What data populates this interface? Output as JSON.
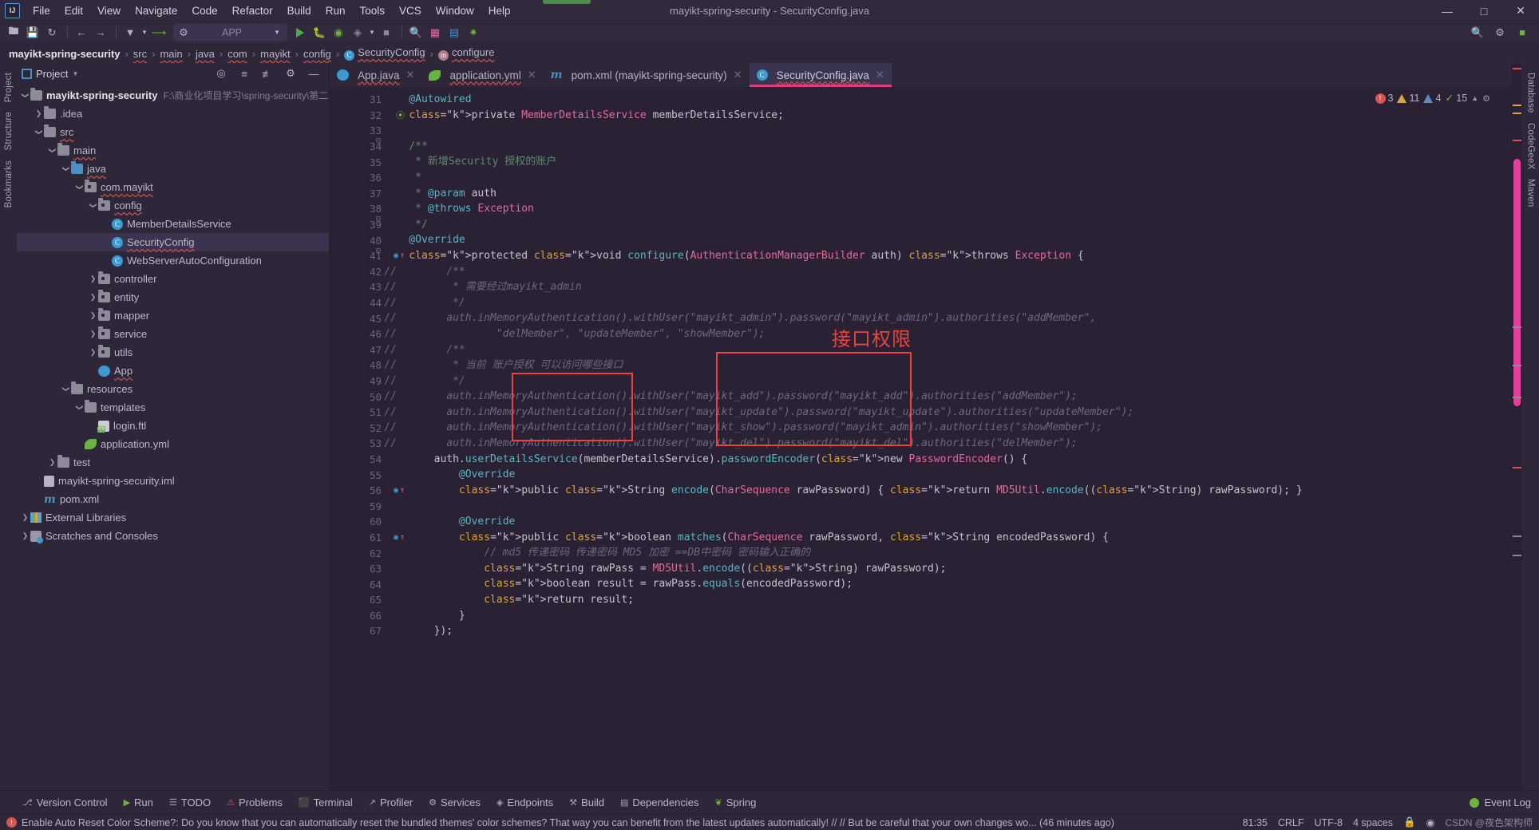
{
  "window": {
    "title": "mayikt-spring-security - SecurityConfig.java",
    "controls": {
      "minimize": "—",
      "maximize": "□",
      "close": "✕"
    }
  },
  "menu": [
    "File",
    "Edit",
    "View",
    "Navigate",
    "Code",
    "Refactor",
    "Build",
    "Run",
    "Tools",
    "VCS",
    "Window",
    "Help"
  ],
  "toolbar": {
    "run_config": "APP",
    "icons": [
      "open-folder-icon",
      "save-icon",
      "sync-icon",
      "back-arrow-icon",
      "forward-arrow-icon",
      "vcs-update-icon",
      "vcs-commit-icon",
      "run-icon",
      "debug-icon",
      "run-coverage-icon",
      "profile-icon",
      "stop-icon",
      "search-everywhere-icon",
      "structure-icon",
      "database-icon",
      "plugin-icon",
      "build-icon",
      "ai-icon"
    ],
    "right_icons": [
      "search-icon",
      "settings-icon",
      "account-icon"
    ]
  },
  "breadcrumb": [
    {
      "label": "mayikt-spring-security",
      "icon": "",
      "first": true
    },
    {
      "label": "src",
      "icon": ""
    },
    {
      "label": "main",
      "icon": ""
    },
    {
      "label": "java",
      "icon": ""
    },
    {
      "label": "com",
      "icon": ""
    },
    {
      "label": "mayikt",
      "icon": ""
    },
    {
      "label": "config",
      "icon": ""
    },
    {
      "label": "SecurityConfig",
      "icon": "C"
    },
    {
      "label": "configure",
      "icon": "m"
    }
  ],
  "left_strip": [
    "Project",
    "Structure",
    "Bookmarks"
  ],
  "right_strip": [
    "Database",
    "CodeGeeX",
    "Maven"
  ],
  "project_panel": {
    "title": "Project",
    "header_icons": [
      "locate-icon",
      "expand-all-icon",
      "collapse-all-icon",
      "settings-icon",
      "hide-icon"
    ],
    "tree": [
      {
        "indent": 0,
        "arrow": "v",
        "icon": "module",
        "label": "mayikt-spring-security",
        "bold": true,
        "path": "F:\\商业化项目学习\\spring-security\\第二次学\\spring-s"
      },
      {
        "indent": 1,
        "arrow": ">",
        "icon": "folder",
        "label": ".idea"
      },
      {
        "indent": 1,
        "arrow": "v",
        "icon": "folder",
        "label": "src",
        "wavy": true
      },
      {
        "indent": 2,
        "arrow": "v",
        "icon": "folder",
        "label": "main",
        "wavy": true
      },
      {
        "indent": 3,
        "arrow": "v",
        "icon": "folder-blue",
        "label": "java",
        "wavy": true
      },
      {
        "indent": 4,
        "arrow": "v",
        "icon": "package",
        "label": "com.mayikt",
        "wavy": true
      },
      {
        "indent": 5,
        "arrow": "v",
        "icon": "package",
        "label": "config",
        "wavy": true
      },
      {
        "indent": 6,
        "arrow": "",
        "icon": "class",
        "label": "MemberDetailsService"
      },
      {
        "indent": 6,
        "arrow": "",
        "icon": "class",
        "label": "SecurityConfig",
        "selected": true,
        "wavy": true
      },
      {
        "indent": 6,
        "arrow": "",
        "icon": "class",
        "label": "WebServerAutoConfiguration"
      },
      {
        "indent": 5,
        "arrow": ">",
        "icon": "package",
        "label": "controller"
      },
      {
        "indent": 5,
        "arrow": ">",
        "icon": "package",
        "label": "entity"
      },
      {
        "indent": 5,
        "arrow": ">",
        "icon": "package",
        "label": "mapper"
      },
      {
        "indent": 5,
        "arrow": ">",
        "icon": "package",
        "label": "service"
      },
      {
        "indent": 5,
        "arrow": ">",
        "icon": "package",
        "label": "utils"
      },
      {
        "indent": 5,
        "arrow": "",
        "icon": "spring-class",
        "label": "App",
        "wavy": true
      },
      {
        "indent": 3,
        "arrow": "v",
        "icon": "resources",
        "label": "resources"
      },
      {
        "indent": 4,
        "arrow": "v",
        "icon": "folder",
        "label": "templates"
      },
      {
        "indent": 5,
        "arrow": "",
        "icon": "ftl",
        "label": "login.ftl"
      },
      {
        "indent": 4,
        "arrow": "",
        "icon": "yml",
        "label": "application.yml"
      },
      {
        "indent": 2,
        "arrow": ">",
        "icon": "folder",
        "label": "test"
      },
      {
        "indent": 1,
        "arrow": "",
        "icon": "iml",
        "label": "mayikt-spring-security.iml"
      },
      {
        "indent": 1,
        "arrow": "",
        "icon": "maven",
        "label": "pom.xml"
      },
      {
        "indent": 0,
        "arrow": ">",
        "icon": "library",
        "label": "External Libraries"
      },
      {
        "indent": 0,
        "arrow": ">",
        "icon": "scratch",
        "label": "Scratches and Consoles"
      }
    ]
  },
  "editor": {
    "tabs": [
      {
        "label": "App.java",
        "icon": "spring-class-icon",
        "active": false,
        "wavy": true
      },
      {
        "label": "application.yml",
        "icon": "spring-yml-icon",
        "active": false,
        "wavy": true
      },
      {
        "label": "pom.xml (mayikt-spring-security)",
        "icon": "maven-icon",
        "active": false
      },
      {
        "label": "SecurityConfig.java",
        "icon": "class-icon",
        "active": true,
        "wavy": true
      }
    ],
    "inspection": {
      "errors": "3",
      "warnings": "11",
      "weak_warnings": "4",
      "typos": "15"
    },
    "first_line_number": 31,
    "lines": [
      {
        "n": 31,
        "text": "    @Autowired"
      },
      {
        "n": 32,
        "text": "    private MemberDetailsService memberDetailsService;",
        "bean": true
      },
      {
        "n": 33,
        "text": ""
      },
      {
        "n": 34,
        "text": "    /**"
      },
      {
        "n": 35,
        "text": "     * 新增Security 授权的账户"
      },
      {
        "n": 36,
        "text": "     *"
      },
      {
        "n": 37,
        "text": "     * @param auth"
      },
      {
        "n": 38,
        "text": "     * @throws Exception"
      },
      {
        "n": 39,
        "text": "     */"
      },
      {
        "n": 40,
        "text": "    @Override"
      },
      {
        "n": 41,
        "text": "    protected void configure(AuthenticationManagerBuilder auth) throws Exception {",
        "override": true
      },
      {
        "n": 42,
        "text": "//        /**",
        "commented": true
      },
      {
        "n": 43,
        "text": "//         * 需要经过mayikt_admin",
        "commented": true
      },
      {
        "n": 44,
        "text": "//         */",
        "commented": true
      },
      {
        "n": 45,
        "text": "//        auth.inMemoryAuthentication().withUser(\"mayikt_admin\").password(\"mayikt_admin\").authorities(\"addMember\",",
        "commented": true
      },
      {
        "n": 46,
        "text": "//                \"delMember\", \"updateMember\", \"showMember\");",
        "commented": true
      },
      {
        "n": 47,
        "text": "//        /**",
        "commented": true
      },
      {
        "n": 48,
        "text": "//         * 当前 账户授权 可以访问哪些接口",
        "commented": true
      },
      {
        "n": 49,
        "text": "//         */",
        "commented": true
      },
      {
        "n": 50,
        "text": "//        auth.inMemoryAuthentication().withUser(\"mayikt_add\").password(\"mayikt_add\").authorities(\"addMember\");",
        "commented": true
      },
      {
        "n": 51,
        "text": "//        auth.inMemoryAuthentication().withUser(\"mayikt_update\").password(\"mayikt_update\").authorities(\"updateMember\");",
        "commented": true
      },
      {
        "n": 52,
        "text": "//        auth.inMemoryAuthentication().withUser(\"mayikt_show\").password(\"mayikt_admin\").authorities(\"showMember\");",
        "commented": true
      },
      {
        "n": 53,
        "text": "//        auth.inMemoryAuthentication().withUser(\"mayikt_del\").password(\"mayikt_del\").authorities(\"delMember\");",
        "commented": true
      },
      {
        "n": 54,
        "text": "        auth.userDetailsService(memberDetailsService).passwordEncoder(new PasswordEncoder() {"
      },
      {
        "n": 55,
        "text": "            @Override"
      },
      {
        "n": 56,
        "text": "            public String encode(CharSequence rawPassword) { return MD5Util.encode((String) rawPassword); }",
        "override": true
      },
      {
        "n": 59,
        "text": ""
      },
      {
        "n": 60,
        "text": "            @Override"
      },
      {
        "n": 61,
        "text": "            public boolean matches(CharSequence rawPassword, String encodedPassword) {",
        "override": true
      },
      {
        "n": 62,
        "text": "                // md5 传递密码 传递密码 MD5 加密 ==DB中密码 密码输入正确的"
      },
      {
        "n": 63,
        "text": "                String rawPass = MD5Util.encode((String) rawPassword);"
      },
      {
        "n": 64,
        "text": "                boolean result = rawPass.equals(encodedPassword);"
      },
      {
        "n": 65,
        "text": "                return result;"
      },
      {
        "n": 66,
        "text": "            }"
      },
      {
        "n": 67,
        "text": "        });"
      }
    ],
    "annotation": "接口权限"
  },
  "bottom_bar": {
    "tools": [
      {
        "label": "Version Control",
        "icon": "branch-icon"
      },
      {
        "label": "Run",
        "icon": "run-icon"
      },
      {
        "label": "TODO",
        "icon": "todo-icon"
      },
      {
        "label": "Problems",
        "icon": "problems-icon"
      },
      {
        "label": "Terminal",
        "icon": "terminal-icon"
      },
      {
        "label": "Profiler",
        "icon": "profiler-icon"
      },
      {
        "label": "Services",
        "icon": "services-icon"
      },
      {
        "label": "Endpoints",
        "icon": "endpoints-icon"
      },
      {
        "label": "Build",
        "icon": "build-icon"
      },
      {
        "label": "Dependencies",
        "icon": "dependencies-icon"
      },
      {
        "label": "Spring",
        "icon": "spring-icon"
      }
    ],
    "event_log": "Event Log"
  },
  "status_bar": {
    "message": "Enable Auto Reset Color Scheme?: Do you know that you can automatically reset the bundled themes' color schemes? That way you can benefit from the latest updates automatically! // // But be careful that your own changes wo... (46 minutes ago)",
    "caret": "81:35",
    "line_separator": "CRLF",
    "encoding": "UTF-8",
    "indent": "4 spaces",
    "watermark": "CSDN @夜色架构师"
  },
  "colors": {
    "accent_pink": "#d9417e",
    "highlight_red": "#e8453c",
    "selection": "#3b3450",
    "editor_bg": "#2b2135",
    "panel_bg": "#2e2739"
  }
}
